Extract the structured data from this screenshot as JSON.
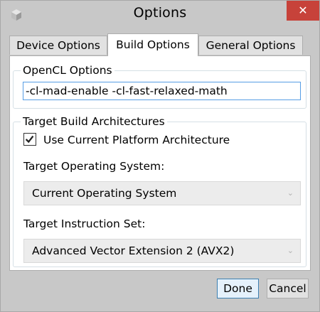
{
  "window": {
    "title": "Options",
    "close_glyph": "✕"
  },
  "tabs": [
    {
      "label": "Device Options",
      "active": false
    },
    {
      "label": "Build Options",
      "active": true
    },
    {
      "label": "General Options",
      "active": false
    }
  ],
  "opencl": {
    "legend": "OpenCL Options",
    "value": "-cl-mad-enable -cl-fast-relaxed-math"
  },
  "target": {
    "legend": "Target Build Architectures",
    "use_current": {
      "label": "Use Current Platform Architecture",
      "checked": true,
      "check_glyph": "✔"
    },
    "os_label": "Target Operating System:",
    "os_value": "Current Operating System",
    "isa_label": "Target Instruction Set:",
    "isa_value": "Advanced Vector Extension 2 (AVX2)",
    "dropdown_glyph": "⌄"
  },
  "buttons": {
    "done": "Done",
    "cancel": "Cancel"
  },
  "colors": {
    "close_bg": "#c7423a",
    "focus_border": "#569de5",
    "default_button_border": "#3c7fb1"
  },
  "icons": [
    "app-cube-icon",
    "close-icon",
    "checkmark-icon",
    "chevron-down-icon"
  ]
}
